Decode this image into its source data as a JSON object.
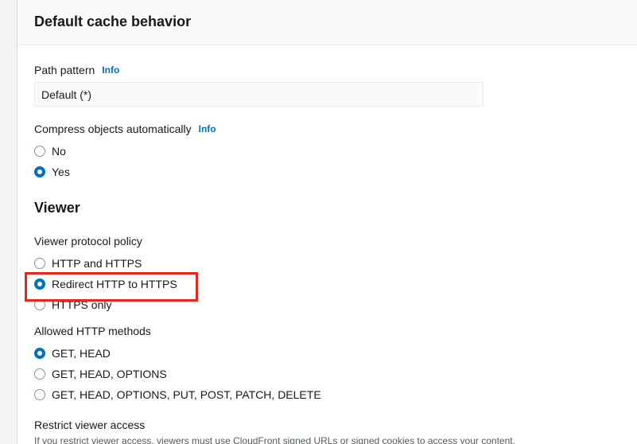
{
  "header": {
    "title": "Default cache behavior"
  },
  "path_pattern": {
    "label": "Path pattern",
    "info": "Info",
    "value": "Default (*)"
  },
  "compress": {
    "label": "Compress objects automatically",
    "info": "Info",
    "options": [
      {
        "label": "No",
        "checked": false
      },
      {
        "label": "Yes",
        "checked": true
      }
    ]
  },
  "viewer": {
    "title": "Viewer",
    "protocol_policy": {
      "label": "Viewer protocol policy",
      "options": [
        {
          "label": "HTTP and HTTPS",
          "checked": false
        },
        {
          "label": "Redirect HTTP to HTTPS",
          "checked": true
        },
        {
          "label": "HTTPS only",
          "checked": false
        }
      ]
    },
    "allowed_methods": {
      "label": "Allowed HTTP methods",
      "options": [
        {
          "label": "GET, HEAD",
          "checked": true
        },
        {
          "label": "GET, HEAD, OPTIONS",
          "checked": false
        },
        {
          "label": "GET, HEAD, OPTIONS, PUT, POST, PATCH, DELETE",
          "checked": false
        }
      ]
    },
    "restrict_access": {
      "label": "Restrict viewer access",
      "helper": "If you restrict viewer access, viewers must use CloudFront signed URLs or signed cookies to access your content."
    }
  },
  "colors": {
    "accent": "#0073bb",
    "highlight": "#e8261c",
    "text": "#16191f"
  }
}
